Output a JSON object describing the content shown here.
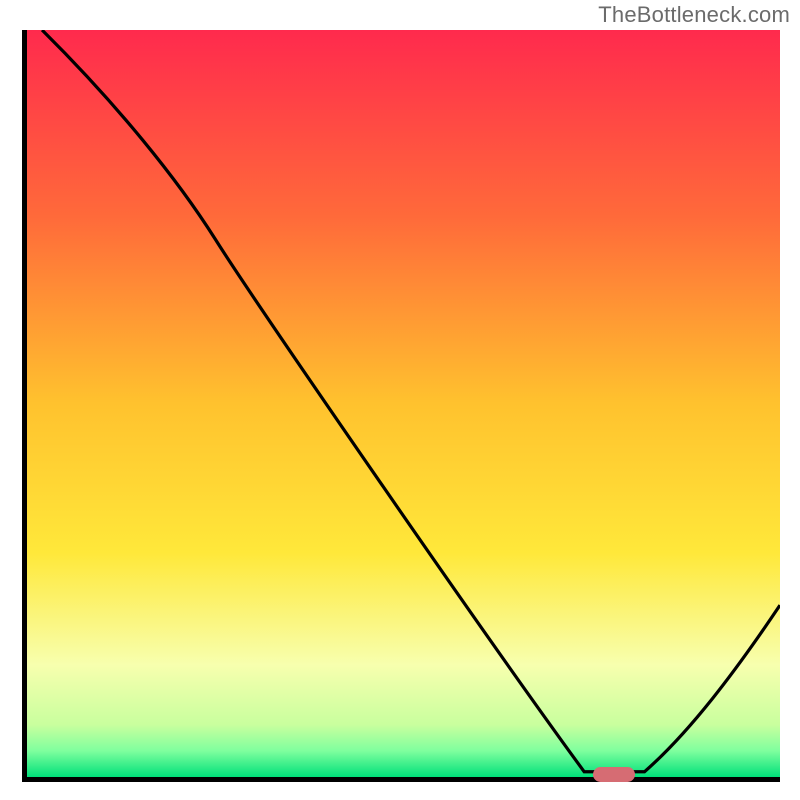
{
  "watermark": "TheBottleneck.com",
  "chart_data": {
    "type": "line",
    "title": "",
    "xlabel": "",
    "ylabel": "",
    "xlim": [
      0,
      100
    ],
    "ylim": [
      0,
      100
    ],
    "x": [
      2,
      25,
      82,
      100
    ],
    "y": [
      100,
      72,
      0,
      23
    ],
    "note": "Bottleneck curve: steep drop then V-shape; minimum near x≈78 where marker sits",
    "marker": {
      "x": 78,
      "y": 0
    },
    "gradient_stops": [
      {
        "pos": 0.0,
        "color": "#ff2a4d"
      },
      {
        "pos": 0.25,
        "color": "#ff6a3a"
      },
      {
        "pos": 0.5,
        "color": "#ffc22e"
      },
      {
        "pos": 0.7,
        "color": "#ffe83a"
      },
      {
        "pos": 0.85,
        "color": "#f7ffae"
      },
      {
        "pos": 0.93,
        "color": "#c9ff9e"
      },
      {
        "pos": 0.965,
        "color": "#7fff9e"
      },
      {
        "pos": 1.0,
        "color": "#00e07a"
      }
    ]
  }
}
